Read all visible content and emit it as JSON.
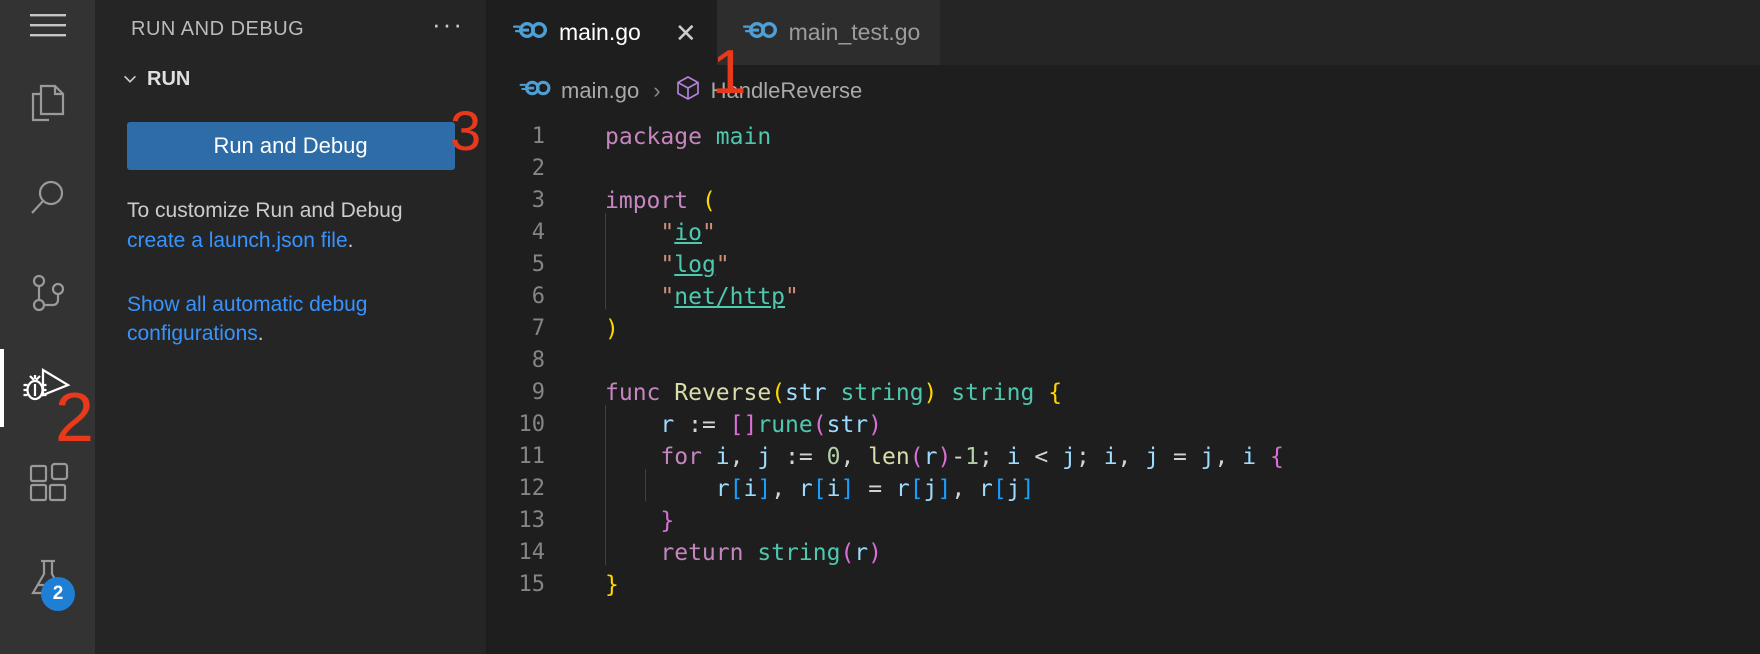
{
  "activity_bar": {
    "items": [
      {
        "name": "menu",
        "icon": "hamburger-icon",
        "label": "Menu",
        "active": false,
        "badge": null
      },
      {
        "name": "explorer",
        "icon": "files-icon",
        "label": "Explorer",
        "active": false,
        "badge": null
      },
      {
        "name": "search",
        "icon": "search-icon",
        "label": "Search",
        "active": false,
        "badge": null
      },
      {
        "name": "source-control",
        "icon": "source-control-icon",
        "label": "Source Control",
        "active": false,
        "badge": null
      },
      {
        "name": "run-and-debug",
        "icon": "run-and-debug-icon",
        "label": "Run and Debug",
        "active": true,
        "badge": null
      },
      {
        "name": "extensions",
        "icon": "extensions-icon",
        "label": "Extensions",
        "active": false,
        "badge": null
      },
      {
        "name": "testing",
        "icon": "beaker-icon",
        "label": "Testing",
        "active": false,
        "badge": "2"
      }
    ]
  },
  "sidebar": {
    "title": "RUN AND DEBUG",
    "more_actions": "···",
    "section": {
      "label": "RUN",
      "expanded": true
    },
    "run_button_label": "Run and Debug",
    "help_text_prefix": "To customize Run and Debug ",
    "help_link": "create a launch.json file",
    "help_text_suffix": ".",
    "automatic_link_line1": "Show all automatic debug",
    "automatic_link_line2": "configurations",
    "automatic_suffix": "."
  },
  "tabs": [
    {
      "label": "main.go",
      "icon": "go-file-icon",
      "active": true,
      "close": "✕"
    },
    {
      "label": "main_test.go",
      "icon": "go-file-icon",
      "active": false,
      "close": ""
    }
  ],
  "breadcrumb": {
    "file_icon": "go-file-icon",
    "file": "main.go",
    "separator": "›",
    "symbol_icon": "symbol-struct-icon",
    "symbol": "HandleReverse"
  },
  "editor": {
    "language": "go",
    "lines": [
      {
        "n": "1",
        "tokens": [
          {
            "t": "package",
            "c": "kw"
          },
          {
            "t": " ",
            "c": "op"
          },
          {
            "t": "main",
            "c": "typ"
          }
        ]
      },
      {
        "n": "2",
        "tokens": []
      },
      {
        "n": "3",
        "tokens": [
          {
            "t": "import",
            "c": "kw"
          },
          {
            "t": " ",
            "c": "op"
          },
          {
            "t": "(",
            "c": "b-y"
          }
        ]
      },
      {
        "n": "4",
        "indent": 1,
        "tokens": [
          {
            "t": "    ",
            "c": "op"
          },
          {
            "t": "\"",
            "c": "str"
          },
          {
            "t": "io",
            "c": "lnk"
          },
          {
            "t": "\"",
            "c": "str"
          }
        ]
      },
      {
        "n": "5",
        "indent": 1,
        "tokens": [
          {
            "t": "    ",
            "c": "op"
          },
          {
            "t": "\"",
            "c": "str"
          },
          {
            "t": "log",
            "c": "lnk"
          },
          {
            "t": "\"",
            "c": "str"
          }
        ]
      },
      {
        "n": "6",
        "indent": 1,
        "tokens": [
          {
            "t": "    ",
            "c": "op"
          },
          {
            "t": "\"",
            "c": "str"
          },
          {
            "t": "net/http",
            "c": "lnk"
          },
          {
            "t": "\"",
            "c": "str"
          }
        ]
      },
      {
        "n": "7",
        "tokens": [
          {
            "t": ")",
            "c": "b-y"
          }
        ]
      },
      {
        "n": "8",
        "tokens": []
      },
      {
        "n": "9",
        "tokens": [
          {
            "t": "func",
            "c": "kw"
          },
          {
            "t": " ",
            "c": "op"
          },
          {
            "t": "Reverse",
            "c": "fn"
          },
          {
            "t": "(",
            "c": "b-y"
          },
          {
            "t": "str",
            "c": "var"
          },
          {
            "t": " ",
            "c": "op"
          },
          {
            "t": "string",
            "c": "typ"
          },
          {
            "t": ")",
            "c": "b-y"
          },
          {
            "t": " ",
            "c": "op"
          },
          {
            "t": "string",
            "c": "typ"
          },
          {
            "t": " ",
            "c": "op"
          },
          {
            "t": "{",
            "c": "b-y"
          }
        ]
      },
      {
        "n": "10",
        "indent": 1,
        "tokens": [
          {
            "t": "    ",
            "c": "op"
          },
          {
            "t": "r",
            "c": "var"
          },
          {
            "t": " := ",
            "c": "op"
          },
          {
            "t": "[]",
            "c": "b-m"
          },
          {
            "t": "rune",
            "c": "typ"
          },
          {
            "t": "(",
            "c": "b-m"
          },
          {
            "t": "str",
            "c": "var"
          },
          {
            "t": ")",
            "c": "b-m"
          }
        ]
      },
      {
        "n": "11",
        "indent": 1,
        "tokens": [
          {
            "t": "    ",
            "c": "op"
          },
          {
            "t": "for",
            "c": "kw"
          },
          {
            "t": " ",
            "c": "op"
          },
          {
            "t": "i",
            "c": "var"
          },
          {
            "t": ", ",
            "c": "op"
          },
          {
            "t": "j",
            "c": "var"
          },
          {
            "t": " := ",
            "c": "op"
          },
          {
            "t": "0",
            "c": "num"
          },
          {
            "t": ", ",
            "c": "op"
          },
          {
            "t": "len",
            "c": "fn"
          },
          {
            "t": "(",
            "c": "b-m"
          },
          {
            "t": "r",
            "c": "var"
          },
          {
            "t": ")",
            "c": "b-m"
          },
          {
            "t": "-",
            "c": "op"
          },
          {
            "t": "1",
            "c": "num"
          },
          {
            "t": "; ",
            "c": "op"
          },
          {
            "t": "i",
            "c": "var"
          },
          {
            "t": " < ",
            "c": "op"
          },
          {
            "t": "j",
            "c": "var"
          },
          {
            "t": "; ",
            "c": "op"
          },
          {
            "t": "i",
            "c": "var"
          },
          {
            "t": ", ",
            "c": "op"
          },
          {
            "t": "j",
            "c": "var"
          },
          {
            "t": " = ",
            "c": "op"
          },
          {
            "t": "j",
            "c": "var"
          },
          {
            "t": ", ",
            "c": "op"
          },
          {
            "t": "i",
            "c": "var"
          },
          {
            "t": " ",
            "c": "op"
          },
          {
            "t": "{",
            "c": "b-m"
          }
        ]
      },
      {
        "n": "12",
        "indent": 2,
        "tokens": [
          {
            "t": "        ",
            "c": "op"
          },
          {
            "t": "r",
            "c": "var"
          },
          {
            "t": "[",
            "c": "b-b"
          },
          {
            "t": "i",
            "c": "var"
          },
          {
            "t": "]",
            "c": "b-b"
          },
          {
            "t": ", ",
            "c": "op"
          },
          {
            "t": "r",
            "c": "var"
          },
          {
            "t": "[",
            "c": "b-b"
          },
          {
            "t": "i",
            "c": "var"
          },
          {
            "t": "]",
            "c": "b-b"
          },
          {
            "t": " = ",
            "c": "op"
          },
          {
            "t": "r",
            "c": "var"
          },
          {
            "t": "[",
            "c": "b-b"
          },
          {
            "t": "j",
            "c": "var"
          },
          {
            "t": "]",
            "c": "b-b"
          },
          {
            "t": ", ",
            "c": "op"
          },
          {
            "t": "r",
            "c": "var"
          },
          {
            "t": "[",
            "c": "b-b"
          },
          {
            "t": "j",
            "c": "var"
          },
          {
            "t": "]",
            "c": "b-b"
          }
        ]
      },
      {
        "n": "13",
        "indent": 1,
        "tokens": [
          {
            "t": "    ",
            "c": "op"
          },
          {
            "t": "}",
            "c": "b-m"
          }
        ]
      },
      {
        "n": "14",
        "indent": 1,
        "tokens": [
          {
            "t": "    ",
            "c": "op"
          },
          {
            "t": "return",
            "c": "kw"
          },
          {
            "t": " ",
            "c": "op"
          },
          {
            "t": "string",
            "c": "typ"
          },
          {
            "t": "(",
            "c": "b-m"
          },
          {
            "t": "r",
            "c": "var"
          },
          {
            "t": ")",
            "c": "b-m"
          }
        ]
      },
      {
        "n": "15",
        "tokens": [
          {
            "t": "}",
            "c": "b-y"
          }
        ]
      }
    ]
  },
  "annotations": [
    {
      "id": "anno1",
      "label": "1"
    },
    {
      "id": "anno2",
      "label": "2"
    },
    {
      "id": "anno3",
      "label": "3"
    }
  ],
  "colors": {
    "accent_button": "#2d6ca6",
    "link": "#3794ff",
    "annotation": "#e8391b",
    "badge": "#1f7fd4",
    "activity_bar_bg": "#333333",
    "sidebar_bg": "#252526",
    "editor_bg": "#1e1e1e"
  }
}
